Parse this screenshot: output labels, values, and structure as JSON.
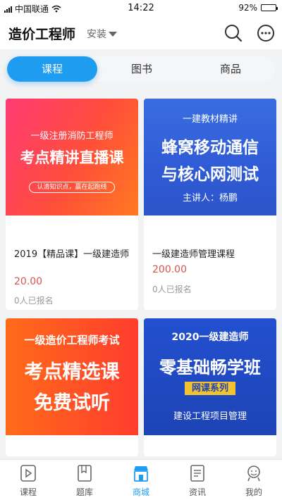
{
  "status_bar": {
    "carrier": "中国联通",
    "time": "14:22",
    "battery": "92%",
    "battery_level": 0.92
  },
  "header": {
    "title": "造价工程师",
    "install_label": "安装"
  },
  "tabs": [
    {
      "label": "课程",
      "active": true
    },
    {
      "label": "图书",
      "active": false
    },
    {
      "label": "商品",
      "active": false
    }
  ],
  "courses": [
    {
      "thumb_lines": [
        "一级注册消防工程师",
        "考点精讲直播课",
        "认清知识点，赢在起跑线"
      ],
      "title": "2019【精品课】一级建造师",
      "price": "20.00",
      "enrolled": "0人已报名"
    },
    {
      "thumb_lines": [
        "一建教材精讲",
        "蜂窝移动通信",
        "与核心网测试",
        "主讲人：杨鹏"
      ],
      "title": "一级建造师管理课程",
      "price": "200.00",
      "enrolled": "0人已报名"
    },
    {
      "thumb_lines": [
        "一级造价工程师考试",
        "考点精选课",
        "免费试听"
      ],
      "title": "",
      "price": "",
      "enrolled": ""
    },
    {
      "thumb_lines": [
        "2020一级建造师",
        "零基础畅学班",
        "网课系列",
        "建设工程项目管理"
      ],
      "title": "",
      "price": "",
      "enrolled": ""
    }
  ],
  "bottom_nav": [
    {
      "label": "课程",
      "icon": "play-icon",
      "active": false
    },
    {
      "label": "题库",
      "icon": "book-icon",
      "active": false
    },
    {
      "label": "商城",
      "icon": "store-icon",
      "active": true
    },
    {
      "label": "资讯",
      "icon": "news-icon",
      "active": false
    },
    {
      "label": "我的",
      "icon": "profile-icon",
      "active": false
    }
  ],
  "colors": {
    "accent": "#1e9cf0",
    "price": "#d9534f"
  }
}
